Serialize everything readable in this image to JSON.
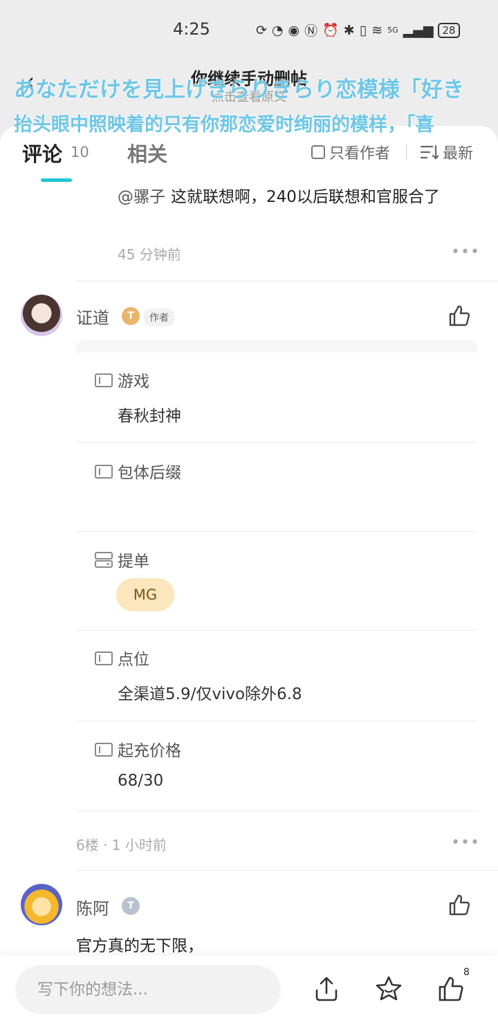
{
  "status_bar": {
    "time": "4:25",
    "icons": [
      "sync-icon",
      "speedometer-icon",
      "eye-icon",
      "nfc-icon",
      "alarm-icon",
      "bluetooth-icon",
      "vibrate-icon",
      "wifi-icon",
      "signal-icon"
    ],
    "network": "5G",
    "battery": "28"
  },
  "header": {
    "title": "你继续手动删帖",
    "subtitle": "点击查看原文"
  },
  "danmaku": [
    "あなただけを見上げきらりきらり恋模様「好き",
    "抬头眼中照映着的只有你那恋爱时绚丽的模样，「喜"
  ],
  "tabs": {
    "comments": "评论",
    "comments_count": "10",
    "related": "相关",
    "author_only": "只看作者",
    "sort": "最新"
  },
  "reply": {
    "mention": "@骡子",
    "text": "这就联想啊，240以后联想和官服合了",
    "time": "45 分钟前"
  },
  "post": {
    "username": "证道",
    "level": "T",
    "author_tag": "作者",
    "fields": [
      {
        "label": "游戏",
        "value": "春秋封神"
      },
      {
        "label": "包体后缀",
        "value": ""
      },
      {
        "label": "提单",
        "tag": "MG"
      },
      {
        "label": "点位",
        "value": "全渠道5.9/仅vivo除外6.8"
      },
      {
        "label": "起充价格",
        "value": "68/30"
      }
    ],
    "meta": "6楼 · 1 小时前"
  },
  "next_comment": {
    "username": "陈阿",
    "level": "T",
    "text": "官方真的无下限，"
  },
  "bottom_bar": {
    "placeholder": "写下你的想法...",
    "like_count": "8"
  },
  "colors": {
    "accent": "#1ec6d4",
    "tag_bg": "#fbe6bd",
    "danmaku": "#6ec7e6"
  }
}
